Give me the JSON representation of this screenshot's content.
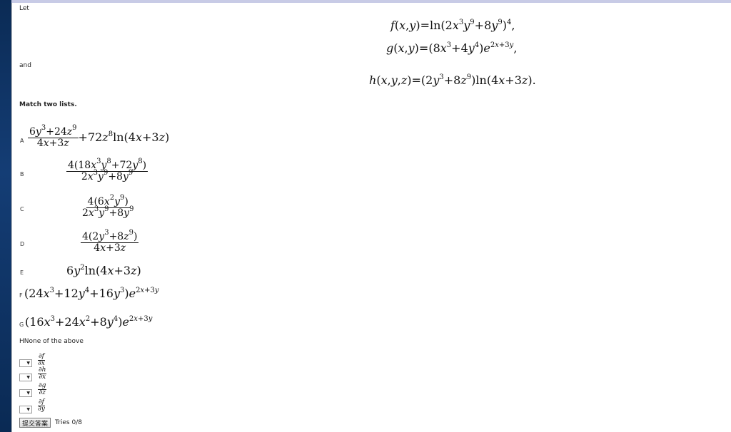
{
  "labels": {
    "let": "Let",
    "and": "and",
    "match": "Match two lists.",
    "none_item": "HNone of the above",
    "tries": "Tries 0/8",
    "submit": "提交答案"
  },
  "definitions": {
    "f_lhs": "f(x,y)",
    "g_lhs": "g(x,y)",
    "h_lhs": "h(x,y,z)"
  },
  "options": [
    "A",
    "B",
    "C",
    "D",
    "E",
    "F",
    "G"
  ],
  "partials": [
    {
      "num": "∂f",
      "den": "∂x"
    },
    {
      "num": "∂h",
      "den": "∂x"
    },
    {
      "num": "∂g",
      "den": "∂z"
    },
    {
      "num": "∂f",
      "den": "∂y"
    }
  ],
  "selects": [
    {
      "selected": ""
    },
    {
      "selected": ""
    },
    {
      "selected": ""
    },
    {
      "selected": ""
    }
  ]
}
